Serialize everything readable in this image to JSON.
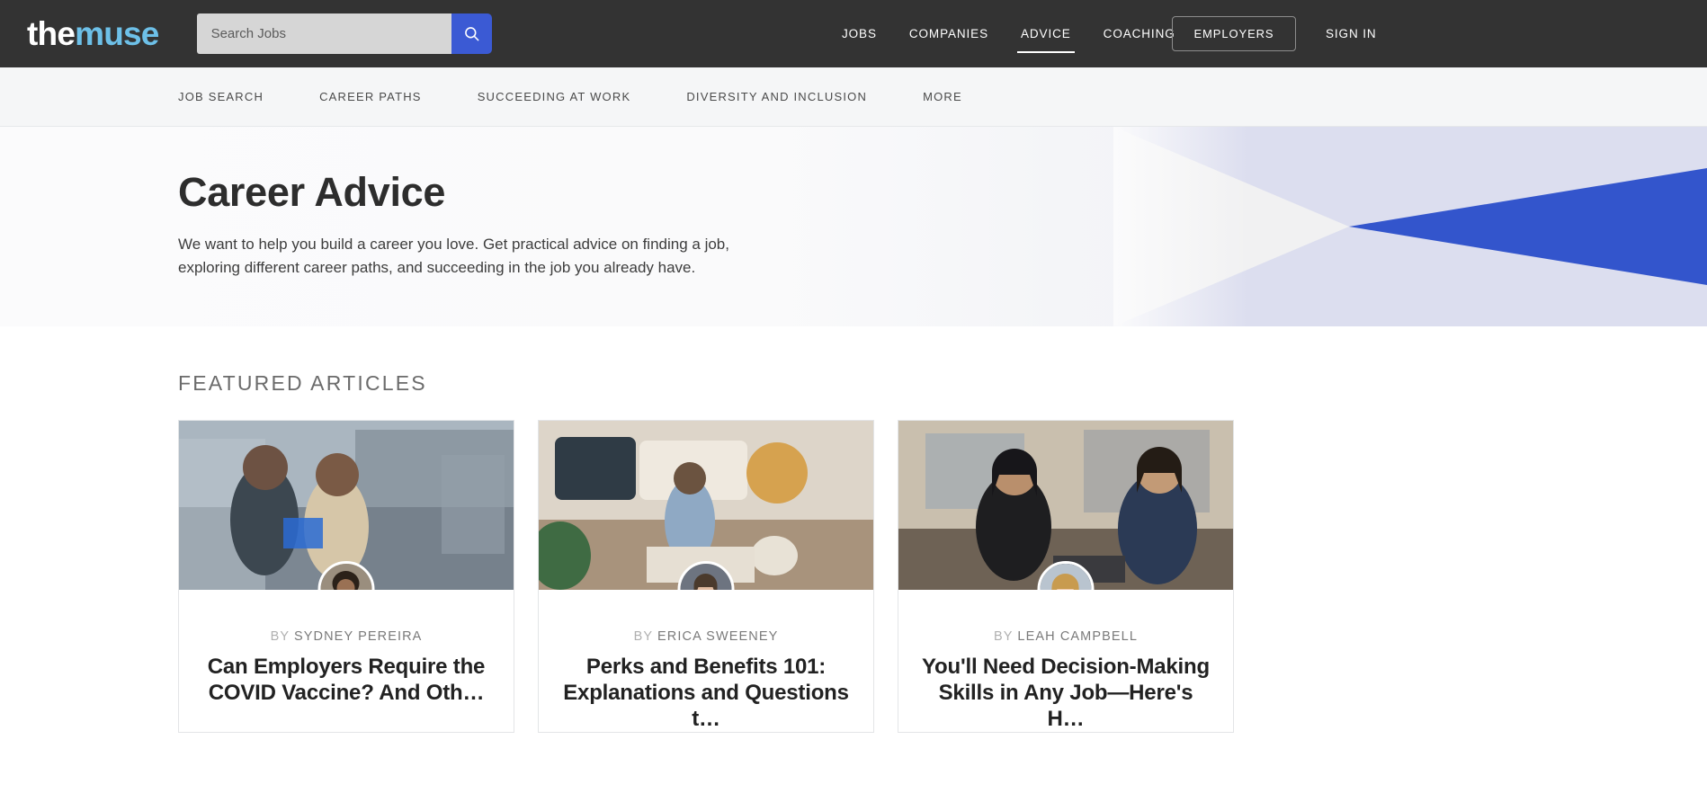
{
  "brand": {
    "logo_primary": "the",
    "logo_secondary": "muse",
    "accent_blue": "#3b5ad4",
    "logo_blue": "#6dc0e8",
    "topbar_bg": "#333333",
    "hero_lavender": "#dcdeef",
    "hero_triangle_blue": "#3355cc"
  },
  "search": {
    "placeholder": "Search Jobs",
    "value": "",
    "icon": "search-icon"
  },
  "topnav": {
    "items": [
      {
        "label": "JOBS",
        "active": false
      },
      {
        "label": "COMPANIES",
        "active": false
      },
      {
        "label": "ADVICE",
        "active": true
      },
      {
        "label": "COACHING",
        "active": false
      }
    ],
    "employers_label": "EMPLOYERS",
    "signin_label": "SIGN IN"
  },
  "subnav": {
    "items": [
      {
        "label": "JOB SEARCH"
      },
      {
        "label": "CAREER PATHS"
      },
      {
        "label": "SUCCEEDING AT WORK"
      },
      {
        "label": "DIVERSITY AND INCLUSION"
      },
      {
        "label": "MORE"
      }
    ]
  },
  "hero": {
    "title": "Career Advice",
    "description": "We want to help you build a career you love. Get practical advice on finding a job, exploring different career paths, and succeeding in the job you already have."
  },
  "featured": {
    "section_title": "FEATURED ARTICLES",
    "by_label": "BY",
    "articles": [
      {
        "author": "SYDNEY PEREIRA",
        "headline": "Can Employers Require the COVID Vaccine? And Oth…",
        "image_alt": "two colleagues in masks reviewing documents in an office"
      },
      {
        "author": "ERICA SWEENEY",
        "headline": "Perks and Benefits 101: Explanations and Questions t…",
        "image_alt": "woman working on floor of living room with baby nearby"
      },
      {
        "author": "LEAH CAMPBELL",
        "headline": "You'll Need Decision-Making Skills in Any Job—Here's H…",
        "image_alt": "two women in conversation at an office table"
      }
    ]
  }
}
